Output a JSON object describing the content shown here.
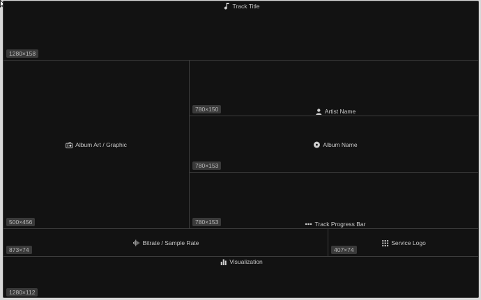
{
  "panels": {
    "track_title": {
      "label": "Track Title",
      "dims": "1280×158"
    },
    "album_art": {
      "label": "Album Art / Graphic",
      "dims": "500×456"
    },
    "artist_name": {
      "label": "Artist Name",
      "dims": "780×150"
    },
    "album_name": {
      "label": "Album Name",
      "dims": "780×153"
    },
    "track_progress": {
      "label": "Track Progress Bar",
      "dims": "780×153"
    },
    "bitrate": {
      "label": "Bitrate / Sample Rate",
      "dims": "873×74"
    },
    "service_logo": {
      "label": "Service Logo",
      "dims": "407×74"
    },
    "visualization": {
      "label": "Visualization",
      "dims": "1280×112"
    }
  },
  "icons": {
    "track_title": "music-note-icon",
    "album_art": "radio-icon",
    "artist_name": "person-icon",
    "album_name": "disc-icon",
    "track_progress": "progress-dots-icon",
    "bitrate": "waveform-icon",
    "service_logo": "grid-icon",
    "visualization": "bar-chart-icon"
  },
  "colors": {
    "background": "#121212",
    "divider": "#3c3c3c",
    "badge": "#3a3a3a",
    "text": "#c9c9c9"
  }
}
